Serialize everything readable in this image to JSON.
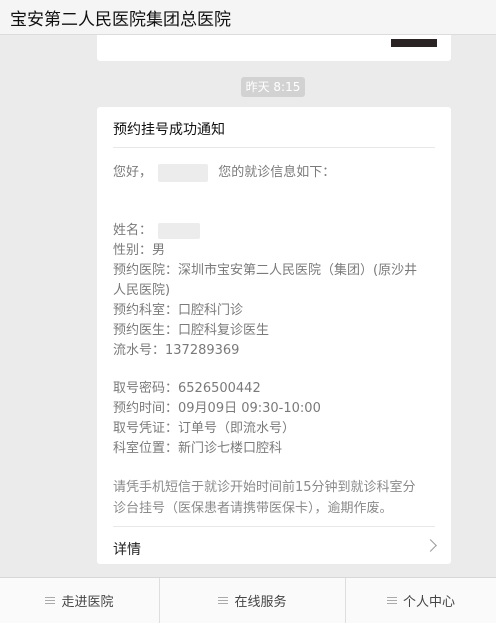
{
  "header": {
    "title": "宝安第二人民医院集团总医院"
  },
  "chat": {
    "time_badge": "昨天 8:15",
    "card": {
      "title": "预约挂号成功通知",
      "greeting_prefix": "您好，",
      "greeting_suffix": "您的就诊信息如下：",
      "name_label": "姓名：",
      "gender": "性别：男",
      "hospital_line1": "预约医院：深圳市宝安第二人民医院（集团）(原沙井",
      "hospital_line2": "人民医院)",
      "department": "预约科室：口腔科门诊",
      "doctor": "预约医生：口腔科复诊医生",
      "serial": "流水号：137289369",
      "code": "取号密码：6526500442",
      "time": "预约时间：09月09日 09:30-10:00",
      "voucher": "取号凭证：订单号（即流水号）",
      "location": "科室位置：新门诊七楼口腔科",
      "notice_line1": "请凭手机短信于就诊开始时间前15分钟到就诊科室分",
      "notice_line2": "诊台挂号（医保患者请携带医保卡），逾期作废。",
      "detail_label": "详情"
    }
  },
  "tabbar": {
    "items": [
      {
        "label": "走进医院",
        "icon": "menu-icon"
      },
      {
        "label": "在线服务",
        "icon": "menu-icon"
      },
      {
        "label": "个人中心",
        "icon": "menu-icon"
      }
    ]
  }
}
